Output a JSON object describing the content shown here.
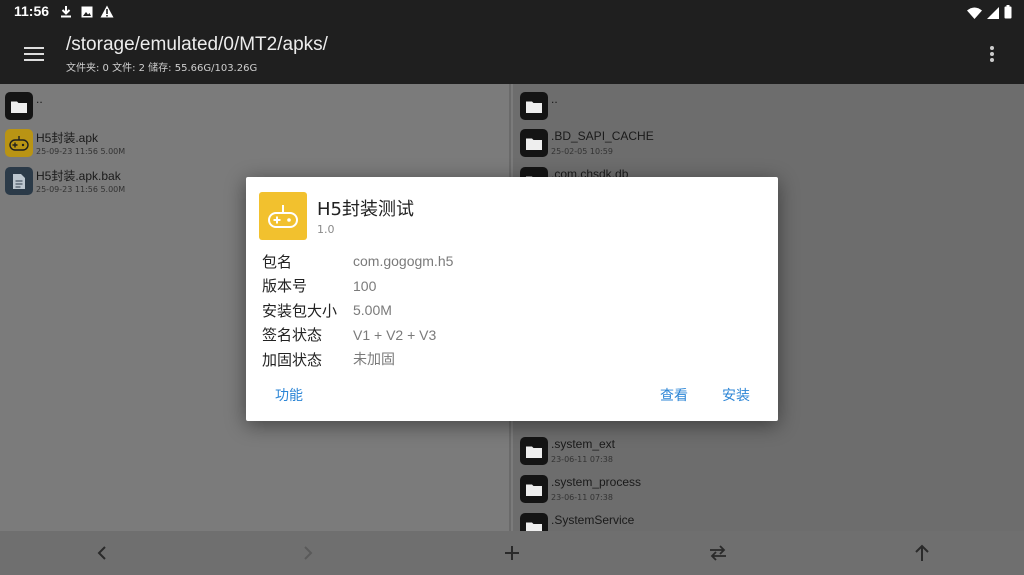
{
  "status_bar": {
    "time": "11:56"
  },
  "app_bar": {
    "path": "/storage/emulated/0/MT2/apks/",
    "info": "文件夹: 0  文件: 2  储存: 55.66G/103.26G"
  },
  "left_pane": {
    "items": [
      {
        "name": "..",
        "meta": ""
      },
      {
        "name": "H5封装.apk",
        "meta": "25-09-23 11:56  5.00M"
      },
      {
        "name": "H5封装.apk.bak",
        "meta": "25-09-23 11:56  5.00M"
      }
    ]
  },
  "right_pane": {
    "items": [
      {
        "name": "..",
        "meta": ""
      },
      {
        "name": ".BD_SAPI_CACHE",
        "meta": "25-02-05 10:59"
      },
      {
        "name": ".com.chsdk.db",
        "meta": ""
      },
      {
        "name": ".system_ext",
        "meta": "23-06-11 07:38"
      },
      {
        "name": ".system_process",
        "meta": "23-06-11 07:38"
      },
      {
        "name": ".SystemService",
        "meta": ""
      }
    ]
  },
  "dialog": {
    "title": "H5封装测试",
    "version": "1.0",
    "properties": [
      {
        "key": "包名",
        "value": "com.gogogm.h5"
      },
      {
        "key": "版本号",
        "value": "100"
      },
      {
        "key": "安装包大小",
        "value": "5.00M"
      },
      {
        "key": "签名状态",
        "value": "V1 + V2 + V3"
      },
      {
        "key": "加固状态",
        "value": "未加固"
      }
    ],
    "buttons": {
      "functions": "功能",
      "view": "查看",
      "install": "安装"
    }
  },
  "colors": {
    "accent": "#2d86d6",
    "app_icon": "#f2c12e",
    "bar": "#1f1f1f"
  },
  "icons": {
    "status": [
      "download-icon",
      "photo-icon",
      "warning-icon",
      "wifi-icon",
      "signal-icon",
      "battery-icon"
    ],
    "app_bar": [
      "menu-icon",
      "more-vert-icon"
    ],
    "bottom_bar": [
      "chevron-left-icon",
      "chevron-right-icon",
      "plus-icon",
      "swap-icon",
      "arrow-up-icon"
    ],
    "app": "gamepad-icon"
  }
}
